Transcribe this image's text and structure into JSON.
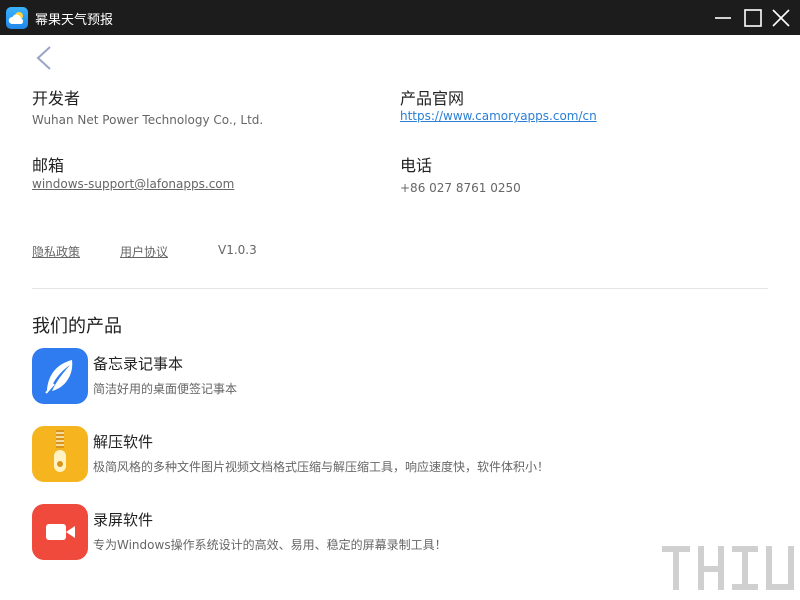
{
  "window": {
    "title": "幂果天气预报"
  },
  "info": {
    "developer": {
      "label": "开发者",
      "value": "Wuhan Net Power Technology Co., Ltd."
    },
    "website": {
      "label": "产品官网",
      "value": "https://www.camoryapps.com/cn"
    },
    "email": {
      "label": "邮箱",
      "value": "windows-support@lafonapps.com"
    },
    "phone": {
      "label": "电话",
      "value": "+86 027 8761 0250"
    }
  },
  "footer": {
    "privacy": "隐私政策",
    "agreement": "用户协议",
    "version": "V1.0.3"
  },
  "products": {
    "title": "我们的产品",
    "items": [
      {
        "name": "备忘录记事本",
        "desc": "简洁好用的桌面便签记事本"
      },
      {
        "name": "解压软件",
        "desc": "极简风格的多种文件图片视频文档格式压缩与解压缩工具，响应速度快，软件体积小！"
      },
      {
        "name": "录屏软件",
        "desc": "专为Windows操作系统设计的高效、易用、稳定的屏幕录制工具！"
      }
    ]
  },
  "colors": {
    "titlebar": "#1c1c1c",
    "link": "#2a7fd4",
    "memo": "#2f7cf0",
    "zip": "#f6b51f",
    "record": "#f04a3c"
  },
  "icons": {
    "app": "weather-cloud-icon",
    "back": "chevron-left-icon",
    "memo": "feather-icon",
    "zip": "zipper-icon",
    "record": "video-camera-icon"
  }
}
